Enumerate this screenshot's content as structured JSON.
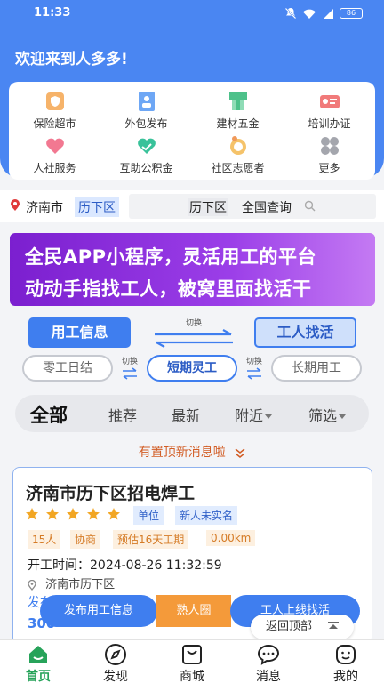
{
  "status_bar": {
    "time": "11:33",
    "battery": "86"
  },
  "header": {
    "welcome": "欢迎来到人多多!"
  },
  "services": [
    {
      "label": "保险超市",
      "icon": "insurance-icon"
    },
    {
      "label": "外包发布",
      "icon": "outsource-icon"
    },
    {
      "label": "建材五金",
      "icon": "hardware-icon"
    },
    {
      "label": "培训办证",
      "icon": "training-icon"
    },
    {
      "label": "人社服务",
      "icon": "social-service-icon"
    },
    {
      "label": "互助公积金",
      "icon": "mutual-fund-icon"
    },
    {
      "label": "社区志愿者",
      "icon": "volunteer-icon"
    },
    {
      "label": "更多",
      "icon": "more-icon"
    }
  ],
  "location": {
    "city": "济南市",
    "district": "历下区"
  },
  "search": {
    "district": "历下区",
    "scope": "全国查询"
  },
  "banner": {
    "line1": "全民APP小程序，灵活用工的平台",
    "line2": "动动手指找工人，被窝里面找活干"
  },
  "mode": {
    "employer": "用工信息",
    "switch": "切换",
    "worker": "工人找活"
  },
  "terms": {
    "daily": "零工日结",
    "short": "短期灵工",
    "long": "长期用工",
    "switch": "切换"
  },
  "filters": {
    "all": "全部",
    "recommend": "推荐",
    "latest": "最新",
    "nearby": "附近",
    "filter": "筛选"
  },
  "notice": "有置顶新消息啦",
  "job": {
    "title": "济南市历下区招电焊工",
    "rating": 5,
    "tag_unit": "单位",
    "tag_unverified": "新人未实名",
    "tags": [
      "15人",
      "协商",
      "预估16天工期",
      "0.00km"
    ],
    "start_label": "开工时间：",
    "start_time": "2024-08-26 11:32:59",
    "location": "济南市历下区",
    "publish_partial": "发布时间",
    "salary_partial": "300"
  },
  "float_actions": {
    "post_job": "发布用工信息",
    "acquaintance": "熟人圈",
    "worker_online": "工人上线找活"
  },
  "back_top": "返回顶部",
  "tabbar": [
    {
      "label": "首页",
      "icon": "home-icon",
      "active": true
    },
    {
      "label": "发现",
      "icon": "compass-icon",
      "active": false
    },
    {
      "label": "商城",
      "icon": "shop-bag-icon",
      "active": false
    },
    {
      "label": "消息",
      "icon": "message-icon",
      "active": false
    },
    {
      "label": "我的",
      "icon": "profile-icon",
      "active": false
    }
  ],
  "colors": {
    "primary": "#4a86f2",
    "accent_orange": "#f49a3a",
    "active_tab": "#27a35a",
    "star": "#f2a623"
  }
}
